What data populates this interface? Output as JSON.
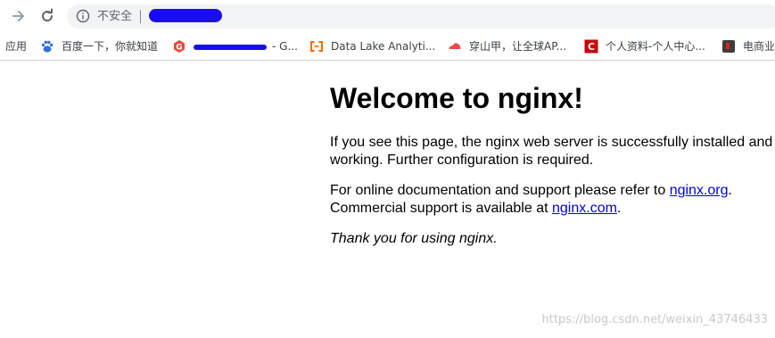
{
  "toolbar": {
    "back_icon": "arrow-right-icon",
    "reload_icon": "reload-icon",
    "omnibox": {
      "security_icon": "info-icon",
      "security_label": "不安全",
      "url": ""
    }
  },
  "bookmarks": {
    "items": [
      {
        "label": "应用",
        "icon": "apps-icon"
      },
      {
        "label": "百度一下，你就知道",
        "icon": "baidu-paw-icon"
      },
      {
        "label": "- G...",
        "icon": "gitee-g-icon"
      },
      {
        "label": "Data Lake Analyti...",
        "icon": "aliyun-bracket-icon"
      },
      {
        "label": "穿山甲，让全球AP...",
        "icon": "pangle-cloud-icon"
      },
      {
        "label": "个人资料-个人中心...",
        "icon": "csdn-c-icon"
      },
      {
        "label": "电商业",
        "icon": "shop-icon"
      }
    ]
  },
  "page": {
    "title": "Welcome to nginx!",
    "p1": "If you see this page, the nginx web server is successfully installed and working. Further configuration is required.",
    "p2_prefix": "For online documentation and support please refer to ",
    "p2_link1": "nginx.org",
    "p2_mid": ".",
    "p2_line2": "Commercial support is available at ",
    "p2_link2": "nginx.com",
    "p2_suffix": ".",
    "p3": "Thank you for using nginx."
  },
  "watermark": "https://blog.csdn.net/weixin_43746433",
  "colors": {
    "link": "#0000ee",
    "redaction": "#1a0cf0",
    "omnibox_bg": "#f1f3f4"
  }
}
